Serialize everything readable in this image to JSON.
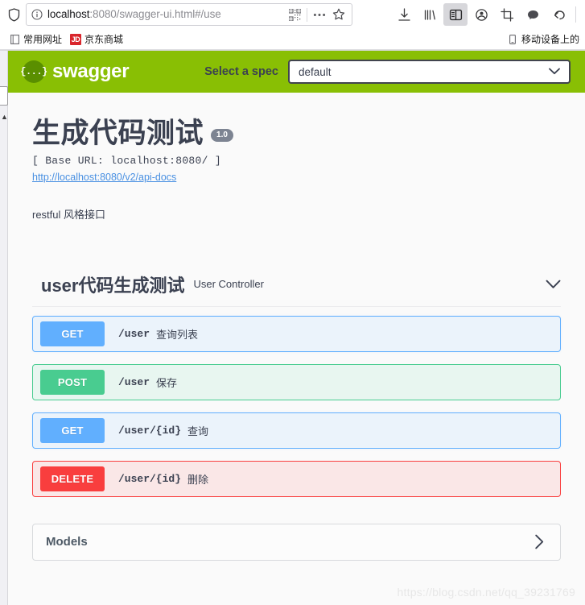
{
  "browser": {
    "url_host": "localhost",
    "url_rest": ":8080/swagger-ui.html#/use",
    "icons": {
      "shield": "shield-icon",
      "info": "info-circle-icon",
      "qr": "qr-code-icon",
      "more": "ellipsis-icon",
      "star": "star-icon",
      "download": "download-icon",
      "library": "library-icon",
      "sidebar": "sidebar-toggle-icon",
      "account": "account-icon",
      "screenshot": "screenshot-crop-icon",
      "chat": "chat-bubble-icon",
      "undo": "undo-arrow-icon"
    },
    "bookmarks": [
      {
        "label": "常用网址",
        "icon": "folder-icon"
      },
      {
        "label": "京东商城",
        "icon": "jd-badge-icon",
        "badge": "JD"
      }
    ],
    "bookmarks_right": {
      "label": "移动设备上的书签",
      "icon": "mobile-device-icon"
    }
  },
  "topbar": {
    "logo_glyph": "{...}",
    "logo_text": "swagger",
    "select_label": "Select a spec",
    "spec_value": "default",
    "chevron": "chevron-down-icon",
    "bg_color": "#89bf04"
  },
  "api": {
    "title": "生成代码测试",
    "version": "1.0",
    "base_url": "[ Base URL: localhost:8080/ ]",
    "docs_link": "http://localhost:8080/v2/api-docs",
    "description": "restful 风格接口"
  },
  "tag": {
    "title": "user代码生成测试",
    "subtitle": "User Controller",
    "chevron": "chevron-down-icon"
  },
  "operations": [
    {
      "method": "GET",
      "method_class": "get",
      "path": "/user",
      "summary": "查询列表",
      "color": "#61affe"
    },
    {
      "method": "POST",
      "method_class": "post",
      "path": "/user",
      "summary": "保存",
      "color": "#49cc90"
    },
    {
      "method": "GET",
      "method_class": "get",
      "path": "/user/{id}",
      "summary": "查询",
      "color": "#61affe"
    },
    {
      "method": "DELETE",
      "method_class": "delete",
      "path": "/user/{id}",
      "summary": "删除",
      "color": "#f93e3e"
    }
  ],
  "models": {
    "title": "Models",
    "chevron": "chevron-right-icon"
  },
  "watermark": "https://blog.csdn.net/qq_39231769"
}
